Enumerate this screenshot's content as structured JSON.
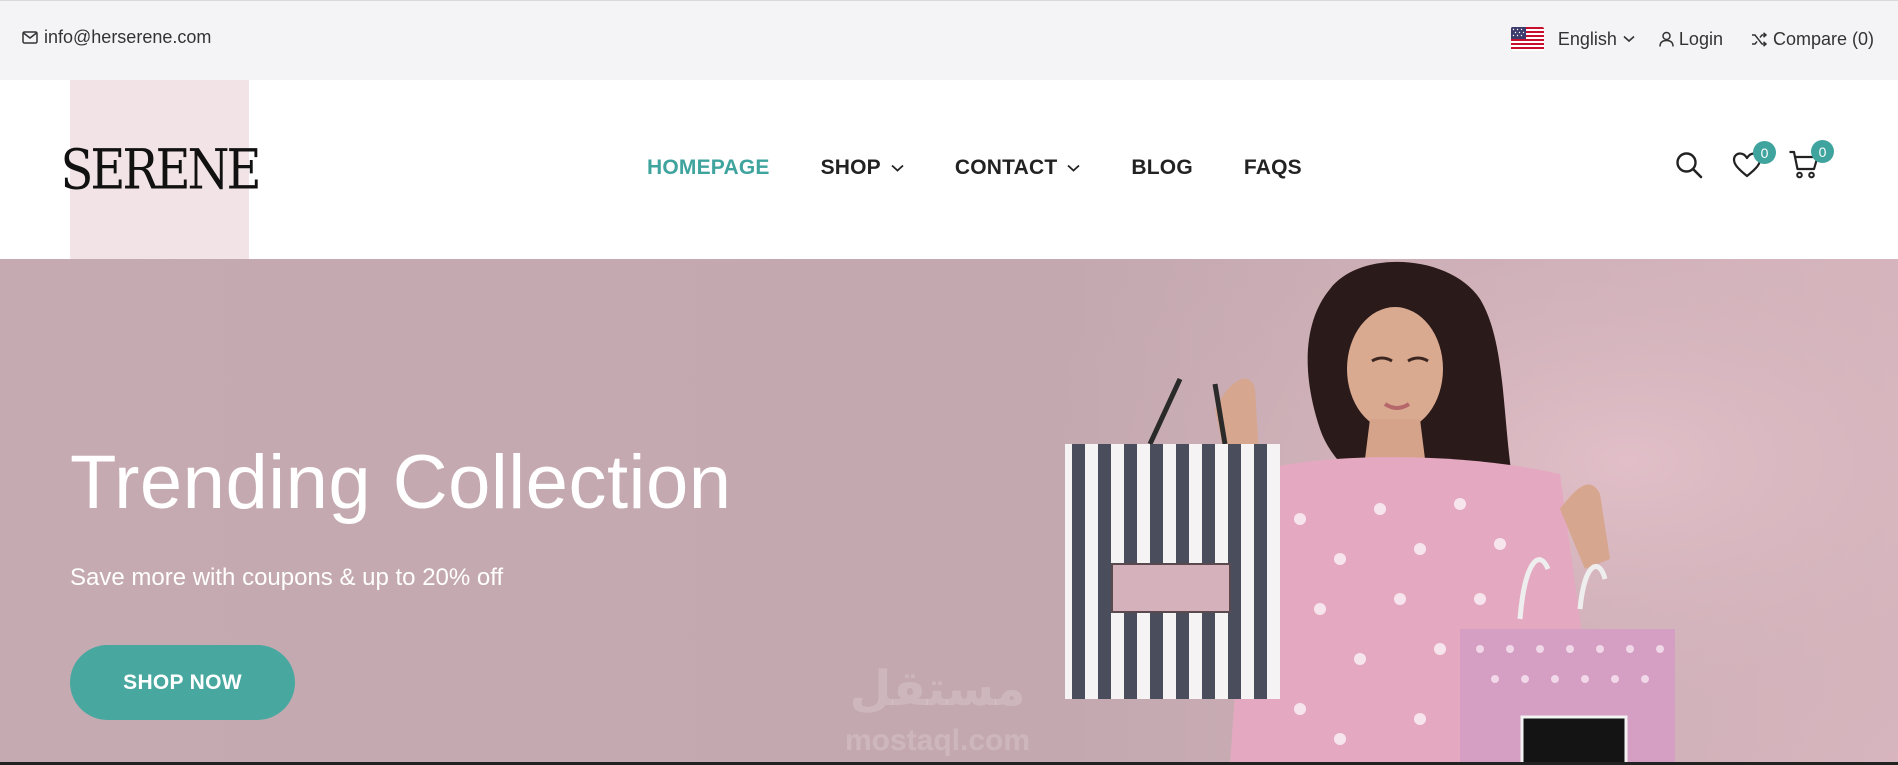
{
  "topbar": {
    "email": "info@herserene.com",
    "language": "English",
    "login": "Login",
    "compare": "Compare (0)"
  },
  "header": {
    "logo": "SERENE",
    "nav": [
      {
        "label": "HOMEPAGE",
        "active": true
      },
      {
        "label": "SHOP",
        "dropdown": true
      },
      {
        "label": "CONTACT",
        "dropdown": true
      },
      {
        "label": "BLOG"
      },
      {
        "label": "FAQS"
      }
    ],
    "wishlist_count": "0",
    "cart_count": "0"
  },
  "hero": {
    "title": "Trending Collection",
    "subtitle": "Save more with coupons & up to 20% off",
    "button": "SHOP NOW"
  },
  "watermark": {
    "arabic": "مستقل",
    "latin": "mostaql.com"
  },
  "colors": {
    "accent": "#3fa39e",
    "hero_bg": "#c5aab1",
    "logo_bg": "#f2e3e6"
  }
}
